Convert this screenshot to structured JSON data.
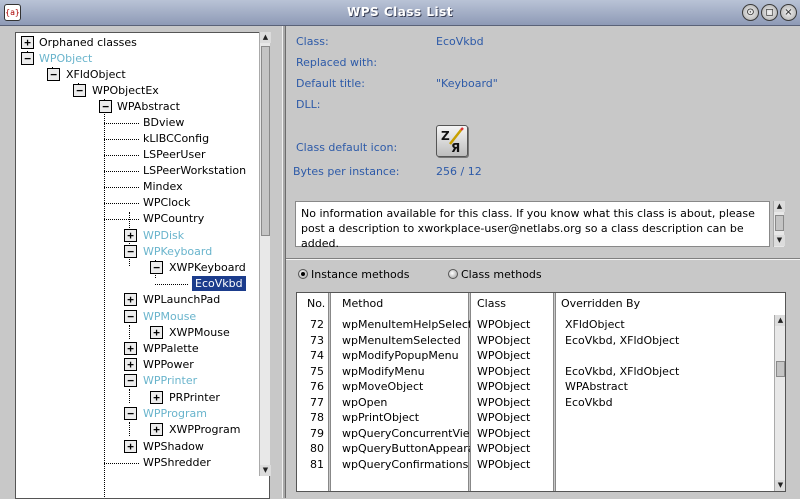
{
  "window": {
    "title": "WPS Class List",
    "sys_icon": "sys-menu-icon"
  },
  "tree": {
    "nodes": [
      {
        "label": "Orphaned classes",
        "toggle": "+",
        "color": "normal"
      },
      {
        "label": "WPObject",
        "toggle": "-",
        "color": "cyan"
      },
      {
        "label": "XFldObject",
        "toggle": "-",
        "color": "normal"
      },
      {
        "label": "WPObjectEx",
        "toggle": "-",
        "color": "normal"
      },
      {
        "label": "WPAbstract",
        "toggle": "-",
        "color": "normal"
      },
      {
        "label": "BDview",
        "toggle": "",
        "color": "normal"
      },
      {
        "label": "kLIBCConfig",
        "toggle": "",
        "color": "normal"
      },
      {
        "label": "LSPeerUser",
        "toggle": "",
        "color": "normal"
      },
      {
        "label": "LSPeerWorkstation",
        "toggle": "",
        "color": "normal"
      },
      {
        "label": "Mindex",
        "toggle": "",
        "color": "normal"
      },
      {
        "label": "WPClock",
        "toggle": "",
        "color": "normal"
      },
      {
        "label": "WPCountry",
        "toggle": "",
        "color": "normal"
      },
      {
        "label": "WPDisk",
        "toggle": "+",
        "color": "cyan"
      },
      {
        "label": "WPKeyboard",
        "toggle": "-",
        "color": "cyan"
      },
      {
        "label": "XWPKeyboard",
        "toggle": "-",
        "color": "normal"
      },
      {
        "label": "EcoVkbd",
        "toggle": "",
        "color": "selected"
      },
      {
        "label": "WPLaunchPad",
        "toggle": "+",
        "color": "normal"
      },
      {
        "label": "WPMouse",
        "toggle": "-",
        "color": "cyan"
      },
      {
        "label": "XWPMouse",
        "toggle": "+",
        "color": "normal"
      },
      {
        "label": "WPPalette",
        "toggle": "+",
        "color": "normal"
      },
      {
        "label": "WPPower",
        "toggle": "+",
        "color": "normal"
      },
      {
        "label": "WPPrinter",
        "toggle": "-",
        "color": "cyan"
      },
      {
        "label": "PRPrinter",
        "toggle": "+",
        "color": "normal"
      },
      {
        "label": "WPProgram",
        "toggle": "-",
        "color": "cyan"
      },
      {
        "label": "XWPProgram",
        "toggle": "+",
        "color": "normal"
      },
      {
        "label": "WPShadow",
        "toggle": "+",
        "color": "normal"
      },
      {
        "label": "WPShredder",
        "toggle": "",
        "color": "normal"
      }
    ]
  },
  "details": {
    "class_label": "Class:",
    "class_value": "EcoVkbd",
    "replaced_label": "Replaced with:",
    "replaced_value": "",
    "title_label": "Default title:",
    "title_value": "\"Keyboard\"",
    "dll_label": "DLL:",
    "dll_value": "",
    "icon_label": "Class default icon:",
    "bytes_label": "Bytes per instance:",
    "bytes_value": "256 / 12",
    "description": "No information available for this class. If you know what this class is about, please post a description to xworkplace-user@netlabs.org so a class description can be added."
  },
  "methods": {
    "instance_label": "Instance methods",
    "class_label": "Class methods",
    "selected": "instance",
    "columns": [
      "No.",
      "Method",
      "Class",
      "Overridden By"
    ],
    "rows": [
      [
        "72",
        "wpMenuItemHelpSelected",
        "WPObject",
        "XFldObject"
      ],
      [
        "73",
        "wpMenuItemSelected",
        "WPObject",
        "EcoVkbd, XFldObject"
      ],
      [
        "74",
        "wpModifyPopupMenu",
        "WPObject",
        ""
      ],
      [
        "75",
        "wpModifyMenu",
        "WPObject",
        "EcoVkbd, XFldObject"
      ],
      [
        "76",
        "wpMoveObject",
        "WPObject",
        "WPAbstract"
      ],
      [
        "77",
        "wpOpen",
        "WPObject",
        "EcoVkbd"
      ],
      [
        "78",
        "wpPrintObject",
        "WPObject",
        ""
      ],
      [
        "79",
        "wpQueryConcurrentView",
        "WPObject",
        ""
      ],
      [
        "80",
        "wpQueryButtonAppearance",
        "WPObject",
        ""
      ],
      [
        "81",
        "wpQueryConfirmations",
        "WPObject",
        ""
      ]
    ]
  },
  "colors": {
    "cyan": "#69b4cc",
    "label_blue": "#2d5aa8",
    "selection": "#1b3c8c"
  }
}
